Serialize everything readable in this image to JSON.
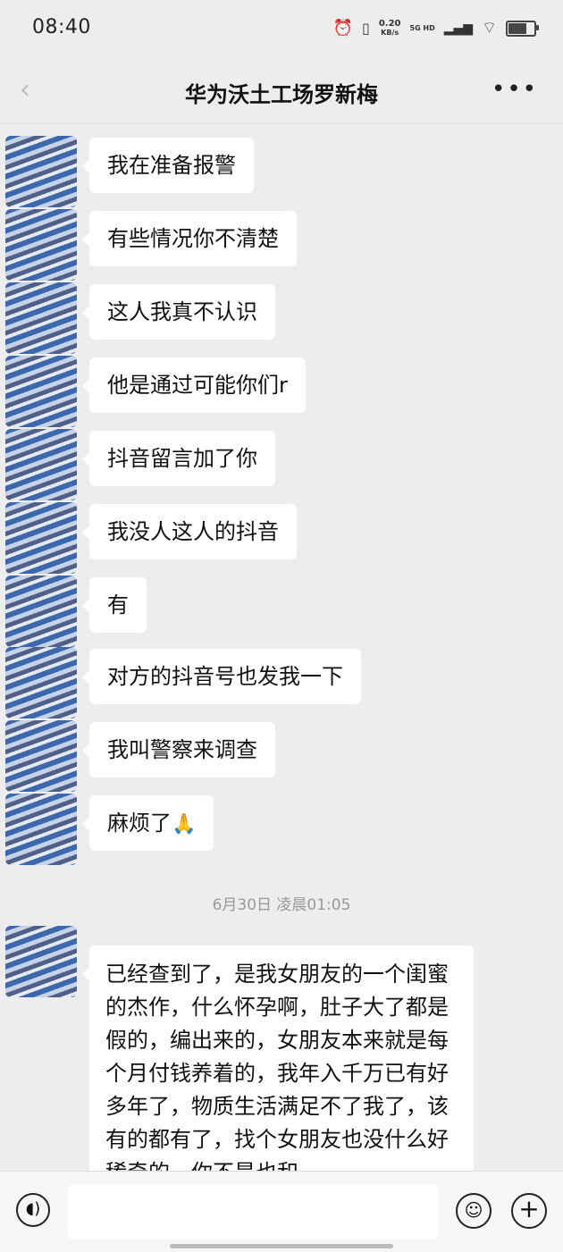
{
  "status_bar": {
    "time": "08:40",
    "net_speed_value": "0.20",
    "net_speed_unit": "KB/s",
    "network": "5G HD",
    "battery_level": 0.75
  },
  "header": {
    "title": "华为沃土工场罗新梅",
    "back_icon": "chevron-left-icon",
    "more_icon": "more-dots-icon"
  },
  "messages": [
    {
      "text": "我在准备报警"
    },
    {
      "text": "有些情况你不清楚"
    },
    {
      "text": "这人我真不认识"
    },
    {
      "text": "他是通过可能你们r"
    },
    {
      "text": "抖音留言加了你"
    },
    {
      "text": "我没人这人的抖音"
    },
    {
      "text": "有"
    },
    {
      "text": "对方的抖音号也发我一下"
    },
    {
      "text": "我叫警察来调查"
    },
    {
      "text": "麻烦了",
      "emoji": "🙏"
    }
  ],
  "timestamp": "6月30日 凌晨01:05",
  "long_message": "已经查到了，是我女朋友的一个闺蜜的杰作，什么怀孕啊，肚子大了都是假的，编出来的，女朋友本来就是每个月付钱养着的，我年入千万已有好多年了，物质生活满足不了我了，该有的都有了，找个女朋友也没什么好稀奇的，你不是也和",
  "input_bar": {
    "voice_icon": "voice-icon",
    "emoji_icon": "smile-icon",
    "plus_icon": "plus-icon",
    "input_value": ""
  }
}
